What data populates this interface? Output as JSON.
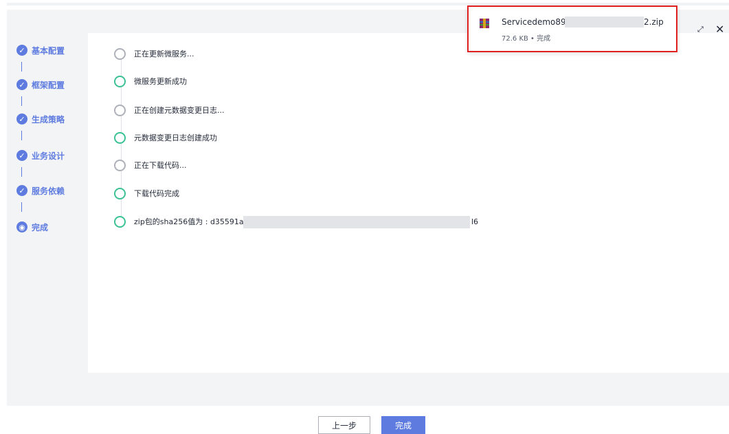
{
  "steps": [
    {
      "label": "基本配置",
      "state": "done"
    },
    {
      "label": "框架配置",
      "state": "done"
    },
    {
      "label": "生成策略",
      "state": "done"
    },
    {
      "label": "业务设计",
      "state": "done"
    },
    {
      "label": "服务依赖",
      "state": "done"
    },
    {
      "label": "完成",
      "state": "current"
    }
  ],
  "timeline": [
    {
      "text": "正在更新微服务...",
      "status": "pending"
    },
    {
      "text": "微服务更新成功",
      "status": "success"
    },
    {
      "text": "正在创建元数据变更日志...",
      "status": "pending"
    },
    {
      "text": "元数据变更日志创建成功",
      "status": "success"
    },
    {
      "text": "正在下载代码...",
      "status": "pending"
    },
    {
      "text": "下载代码完成",
      "status": "success"
    },
    {
      "text": "zip包的sha256值为 : d35591a9",
      "status": "success"
    }
  ],
  "hash_tail": "l6",
  "download": {
    "name_prefix": "Servicedemo89",
    "name_suffix": "2.zip",
    "meta": "72.6 KB • 完成"
  },
  "window": {
    "expand_icon": "expand-icon",
    "close_icon": "close-icon",
    "close_glyph": "✕",
    "expand_glyph": "⤢"
  },
  "buttons": {
    "prev": "上一步",
    "done": "完成"
  },
  "colors": {
    "primary": "#5e7ce0",
    "success": "#3ac295",
    "pending": "#adb0b8",
    "highlight": "#e02020"
  }
}
